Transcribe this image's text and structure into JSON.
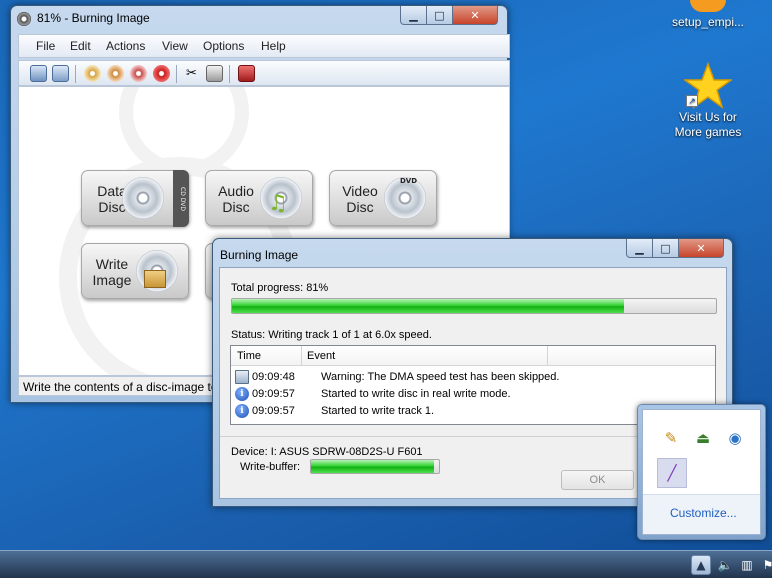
{
  "desktop": {
    "icons": [
      {
        "label": "setup_empi..."
      },
      {
        "label_line1": "Visit Us for",
        "label_line2": "More games"
      }
    ]
  },
  "main_window": {
    "title": "81% - Burning Image",
    "menu": [
      "File",
      "Edit",
      "Actions",
      "View",
      "Options",
      "Help"
    ],
    "buttons": {
      "data_disc": {
        "line1": "Data",
        "line2": "Disc",
        "strip": "CD DVD"
      },
      "audio_disc": {
        "line1": "Audio",
        "line2": "Disc"
      },
      "video_disc": {
        "line1": "Video",
        "line2": "Disc",
        "badge": "DVD"
      },
      "write_image": {
        "line1": "Write",
        "line2": "Image"
      }
    },
    "status": "Write the contents of a disc-image to"
  },
  "dialog": {
    "title": "Burning Image",
    "total_progress_label": "Total progress: 81%",
    "total_progress_value": 81,
    "status": "Status: Writing track 1 of 1 at 6.0x speed.",
    "log_columns": [
      "Time",
      "Event"
    ],
    "log": [
      {
        "time": "09:09:48",
        "event": "Warning: The DMA speed test has been skipped.",
        "icon": "monitor-icon"
      },
      {
        "time": "09:09:57",
        "event": "Started to write disc in real write mode.",
        "icon": "info-icon"
      },
      {
        "time": "09:09:57",
        "event": "Started to write track 1.",
        "icon": "info-icon"
      }
    ],
    "device": "Device: I: ASUS SDRW-08D2S-U F601",
    "write_buffer_label": "Write-buffer:",
    "write_buffer_value": 96,
    "ok_label": "OK"
  },
  "notification_area": {
    "customize": "Customize..."
  },
  "colors": {
    "progress_green": "#13b013",
    "desktop_blue": "#1f78cf",
    "link_blue": "#1e5fbf"
  }
}
